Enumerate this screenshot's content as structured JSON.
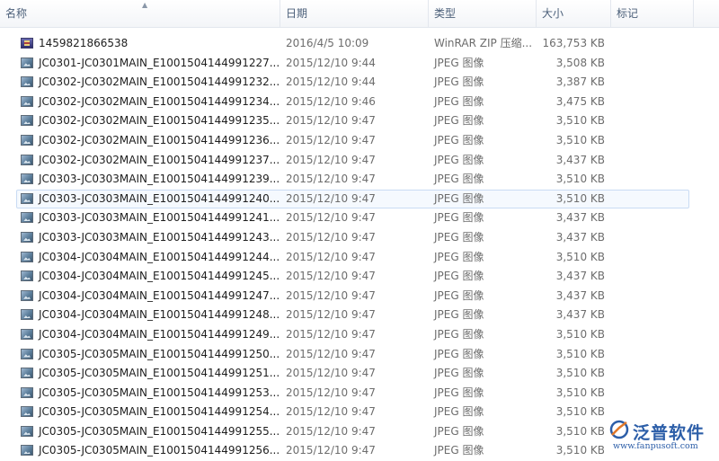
{
  "columns": {
    "name": "名称",
    "date": "日期",
    "type": "类型",
    "size": "大小",
    "tags": "标记"
  },
  "files": [
    {
      "icon": "winrar-archive-icon",
      "name": "1459821866538",
      "date": "2016/4/5 10:09",
      "type": "WinRAR ZIP 压缩...",
      "size": "163,753 KB"
    },
    {
      "icon": "jpeg-image-icon",
      "name": "JC0301-JC0301MAIN_E1001504144991227...",
      "date": "2015/12/10 9:44",
      "type": "JPEG 图像",
      "size": "3,508 KB"
    },
    {
      "icon": "jpeg-image-icon",
      "name": "JC0302-JC0302MAIN_E1001504144991232...",
      "date": "2015/12/10 9:44",
      "type": "JPEG 图像",
      "size": "3,387 KB"
    },
    {
      "icon": "jpeg-image-icon",
      "name": "JC0302-JC0302MAIN_E1001504144991234...",
      "date": "2015/12/10 9:46",
      "type": "JPEG 图像",
      "size": "3,475 KB"
    },
    {
      "icon": "jpeg-image-icon",
      "name": "JC0302-JC0302MAIN_E1001504144991235...",
      "date": "2015/12/10 9:47",
      "type": "JPEG 图像",
      "size": "3,510 KB"
    },
    {
      "icon": "jpeg-image-icon",
      "name": "JC0302-JC0302MAIN_E1001504144991236...",
      "date": "2015/12/10 9:47",
      "type": "JPEG 图像",
      "size": "3,510 KB"
    },
    {
      "icon": "jpeg-image-icon",
      "name": "JC0302-JC0302MAIN_E1001504144991237...",
      "date": "2015/12/10 9:47",
      "type": "JPEG 图像",
      "size": "3,437 KB"
    },
    {
      "icon": "jpeg-image-icon",
      "name": "JC0303-JC0303MAIN_E1001504144991239...",
      "date": "2015/12/10 9:47",
      "type": "JPEG 图像",
      "size": "3,510 KB"
    },
    {
      "icon": "jpeg-image-icon",
      "name": "JC0303-JC0303MAIN_E1001504144991240...",
      "date": "2015/12/10 9:47",
      "type": "JPEG 图像",
      "size": "3,510 KB",
      "selected": true
    },
    {
      "icon": "jpeg-image-icon",
      "name": "JC0303-JC0303MAIN_E1001504144991241...",
      "date": "2015/12/10 9:47",
      "type": "JPEG 图像",
      "size": "3,437 KB"
    },
    {
      "icon": "jpeg-image-icon",
      "name": "JC0303-JC0303MAIN_E1001504144991243...",
      "date": "2015/12/10 9:47",
      "type": "JPEG 图像",
      "size": "3,437 KB"
    },
    {
      "icon": "jpeg-image-icon",
      "name": "JC0304-JC0304MAIN_E1001504144991244...",
      "date": "2015/12/10 9:47",
      "type": "JPEG 图像",
      "size": "3,510 KB"
    },
    {
      "icon": "jpeg-image-icon",
      "name": "JC0304-JC0304MAIN_E1001504144991245...",
      "date": "2015/12/10 9:47",
      "type": "JPEG 图像",
      "size": "3,437 KB"
    },
    {
      "icon": "jpeg-image-icon",
      "name": "JC0304-JC0304MAIN_E1001504144991247...",
      "date": "2015/12/10 9:47",
      "type": "JPEG 图像",
      "size": "3,437 KB"
    },
    {
      "icon": "jpeg-image-icon",
      "name": "JC0304-JC0304MAIN_E1001504144991248...",
      "date": "2015/12/10 9:47",
      "type": "JPEG 图像",
      "size": "3,437 KB"
    },
    {
      "icon": "jpeg-image-icon",
      "name": "JC0304-JC0304MAIN_E1001504144991249...",
      "date": "2015/12/10 9:47",
      "type": "JPEG 图像",
      "size": "3,510 KB"
    },
    {
      "icon": "jpeg-image-icon",
      "name": "JC0305-JC0305MAIN_E1001504144991250...",
      "date": "2015/12/10 9:47",
      "type": "JPEG 图像",
      "size": "3,510 KB"
    },
    {
      "icon": "jpeg-image-icon",
      "name": "JC0305-JC0305MAIN_E1001504144991251...",
      "date": "2015/12/10 9:47",
      "type": "JPEG 图像",
      "size": "3,510 KB"
    },
    {
      "icon": "jpeg-image-icon",
      "name": "JC0305-JC0305MAIN_E1001504144991253...",
      "date": "2015/12/10 9:47",
      "type": "JPEG 图像",
      "size": "3,510 KB"
    },
    {
      "icon": "jpeg-image-icon",
      "name": "JC0305-JC0305MAIN_E1001504144991254...",
      "date": "2015/12/10 9:47",
      "type": "JPEG 图像",
      "size": "3,510 KB"
    },
    {
      "icon": "jpeg-image-icon",
      "name": "JC0305-JC0305MAIN_E1001504144991255...",
      "date": "2015/12/10 9:47",
      "type": "JPEG 图像",
      "size": "3,510 KB"
    },
    {
      "icon": "jpeg-image-icon",
      "name": "JC0305-JC0305MAIN_E1001504144991256...",
      "date": "2015/12/10 9:47",
      "type": "JPEG 图像",
      "size": "3,510 KB"
    }
  ],
  "watermark": {
    "brand": "泛普软件",
    "url": "www.fanpusoft.com"
  },
  "colors": {
    "header_text": "#4c607a",
    "selection_border": "#c9dbf3",
    "brand": "#2c5ea8"
  }
}
